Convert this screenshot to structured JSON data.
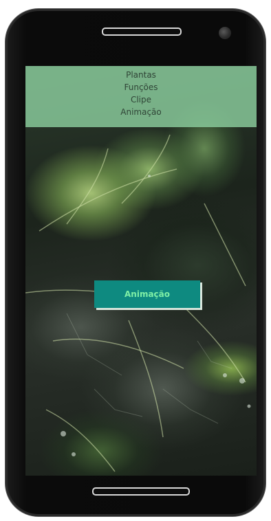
{
  "nav": {
    "items": [
      {
        "label": "Plantas"
      },
      {
        "label": "Funções"
      },
      {
        "label": "Clipe"
      },
      {
        "label": "Animação"
      }
    ]
  },
  "main": {
    "cta_label": "Animação"
  },
  "colors": {
    "nav_overlay": "#8bcd9e",
    "button_bg": "#0e8a80",
    "button_text": "#7ff0a6"
  }
}
